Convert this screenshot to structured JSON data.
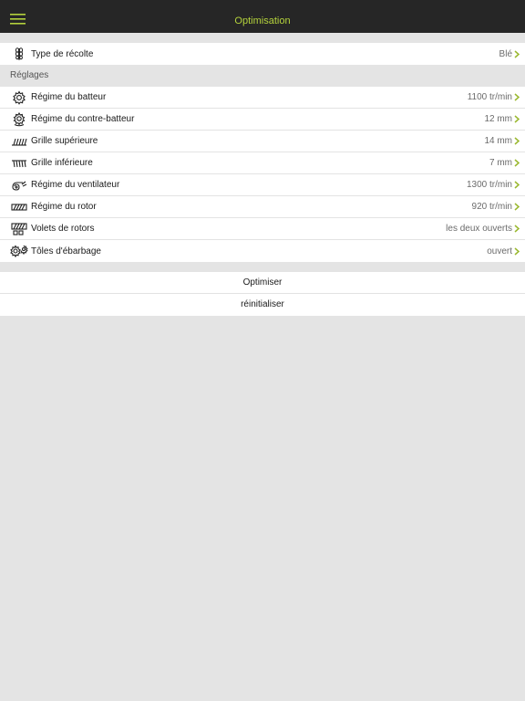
{
  "navbar": {
    "title": "Optimisation",
    "menu_icon": "hamburger-menu-icon",
    "accent_color": "#b4d23c",
    "background_color": "#262626"
  },
  "crop": {
    "label": "Type de récolte",
    "value": "Blé",
    "icon": "wheat-icon"
  },
  "settings": {
    "header": "Réglages",
    "items": [
      {
        "label": "Régime du batteur",
        "value": "1100 tr/min",
        "icon": "thresher-gear-icon"
      },
      {
        "label": "Régime du contre-batteur",
        "value": "12 mm",
        "icon": "concave-gear-icon"
      },
      {
        "label": "Grille supérieure",
        "value": "14 mm",
        "icon": "upper-sieve-icon"
      },
      {
        "label": "Grille inférieure",
        "value": "7 mm",
        "icon": "lower-sieve-icon"
      },
      {
        "label": "Régime du ventilateur",
        "value": "1300 tr/min",
        "icon": "fan-icon"
      },
      {
        "label": "Régime du rotor",
        "value": "920 tr/min",
        "icon": "rotor-icon"
      },
      {
        "label": "Volets de rotors",
        "value": "les deux ouverts",
        "icon": "rotor-flaps-icon"
      },
      {
        "label": "Tôles d'ébarbage",
        "value": "ouvert",
        "icon": "deawning-plates-icon"
      }
    ]
  },
  "actions": {
    "optimize": "Optimiser",
    "reset": "réinitialiser"
  },
  "colors": {
    "chevron": "#9ab82e",
    "page_background": "#e4e4e4"
  }
}
